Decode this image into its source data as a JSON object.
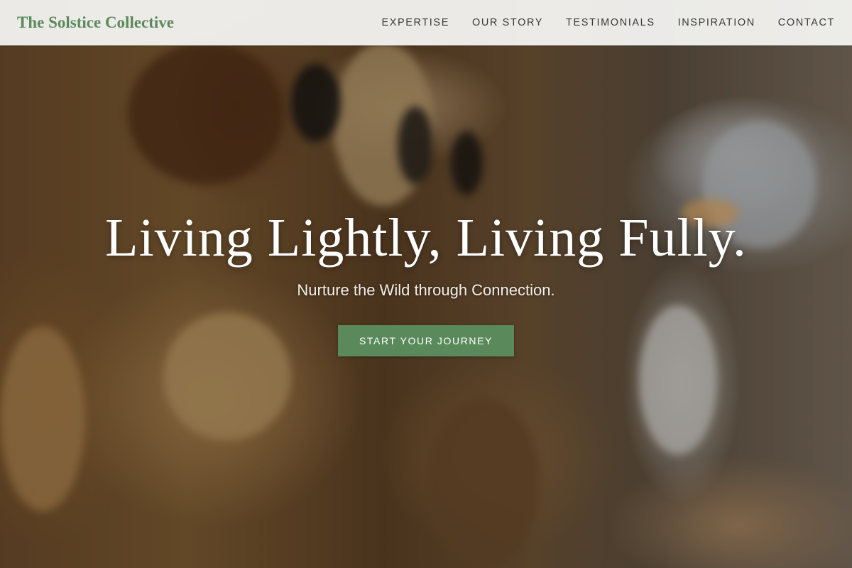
{
  "brand": {
    "name": "The Solstice Collective",
    "color": "#5a8a5c"
  },
  "nav": {
    "items": [
      {
        "label": "EXPERTISE"
      },
      {
        "label": "OUR STORY"
      },
      {
        "label": "TESTIMONIALS"
      },
      {
        "label": "INSPIRATION"
      },
      {
        "label": "CONTACT"
      }
    ]
  },
  "hero": {
    "headline": "Living Lightly, Living Fully.",
    "subheadline": "Nurture the Wild through Connection.",
    "cta_label": "START YOUR JOURNEY",
    "accent_color": "#5a8a5c"
  }
}
